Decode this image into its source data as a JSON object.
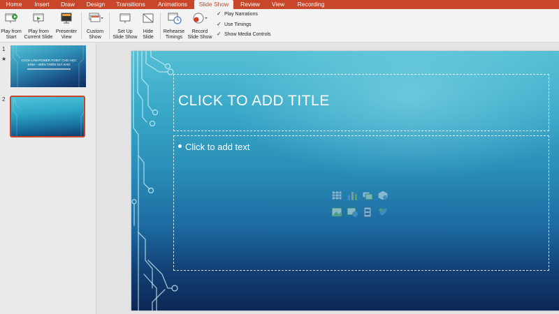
{
  "tabs": [
    {
      "label": "Home",
      "active": false
    },
    {
      "label": "Insert",
      "active": false
    },
    {
      "label": "Draw",
      "active": false
    },
    {
      "label": "Design",
      "active": false
    },
    {
      "label": "Transitions",
      "active": false
    },
    {
      "label": "Animations",
      "active": false
    },
    {
      "label": "Slide Show",
      "active": true
    },
    {
      "label": "Review",
      "active": false
    },
    {
      "label": "View",
      "active": false
    },
    {
      "label": "Recording",
      "active": false
    }
  ],
  "ribbon": {
    "play_from_start": "Play from\nStart",
    "play_from_current": "Play from\nCurrent Slide",
    "presenter_view": "Presenter\nView",
    "custom_show": "Custom\nShow",
    "set_up_slide_show": "Set Up\nSlide Show",
    "hide_slide": "Hide\nSlide",
    "rehearse_timings": "Rehearse\nTimings",
    "record_slide_show": "Record\nSlide Show",
    "play_narrations": "Play Narrations",
    "use_timings": "Use Timings",
    "show_media_controls": "Show Media Controls"
  },
  "checkboxes": {
    "play_narrations": true,
    "use_timings": true,
    "show_media_controls": true
  },
  "thumbnails": [
    {
      "number": "1",
      "marker": "★",
      "title": "CÁCH LÀM POWER POINT CHO HỌC SINH – BIÊN THIÊN GIÁ KHO",
      "selected": false
    },
    {
      "number": "2",
      "marker": "",
      "title": "",
      "selected": true
    }
  ],
  "slide": {
    "title_placeholder": "CLICK TO ADD TITLE",
    "body_placeholder": "Click to add text"
  },
  "icons": {
    "insert_table": "table-icon",
    "insert_chart": "chart-icon",
    "insert_smartart": "smartart-icon",
    "insert_3d": "3d-model-icon",
    "insert_picture": "picture-icon",
    "insert_online_picture": "online-picture-icon",
    "insert_video": "video-icon",
    "insert_icons": "icons-icon"
  },
  "colors": {
    "accent": "#c8472a",
    "ribbon_bg": "#f3f3f3",
    "slide_top": "#55bfd5",
    "slide_bottom": "#0c2756"
  }
}
